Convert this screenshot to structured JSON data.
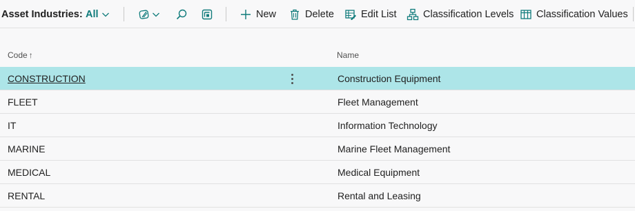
{
  "page": {
    "title": "Asset Industries:",
    "filter_label": "All"
  },
  "toolbar": {
    "new_label": "New",
    "delete_label": "Delete",
    "edit_list_label": "Edit List",
    "classification_levels_label": "Classification Levels",
    "classification_values_label": "Classification Values"
  },
  "table": {
    "columns": {
      "code": "Code",
      "sort_indicator": "↑",
      "name": "Name"
    },
    "selected_row": 0,
    "rows": [
      {
        "code": "CONSTRUCTION",
        "name": "Construction Equipment"
      },
      {
        "code": "FLEET",
        "name": "Fleet Management"
      },
      {
        "code": "IT",
        "name": "Information Technology"
      },
      {
        "code": "MARINE",
        "name": "Marine Fleet Management"
      },
      {
        "code": "MEDICAL",
        "name": "Medical Equipment"
      },
      {
        "code": "RENTAL",
        "name": "Rental and Leasing"
      }
    ]
  },
  "colors": {
    "accent": "#0f7b7b",
    "selected_row": "#ade5e8",
    "background": "#f8f8f9"
  }
}
